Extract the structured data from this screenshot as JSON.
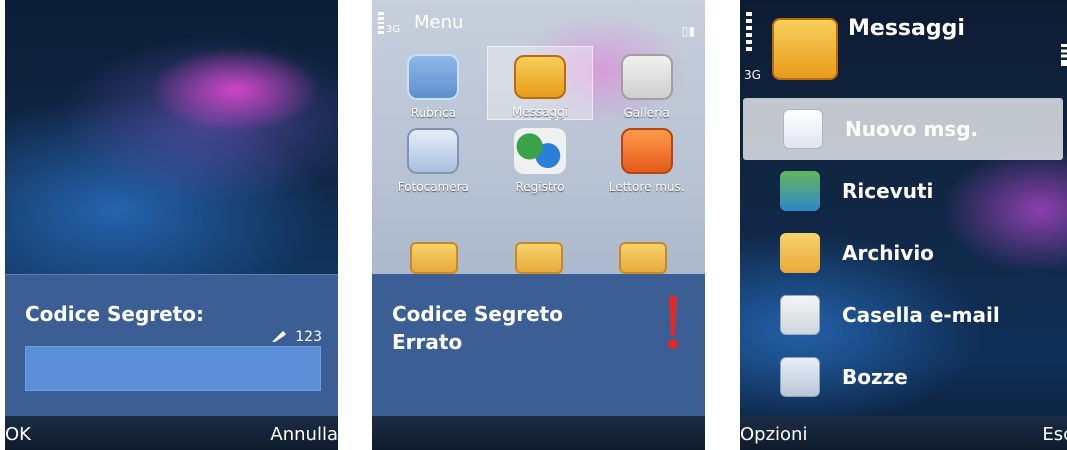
{
  "phone1": {
    "dialog_title": "Codice Segreto:",
    "input_mode": "123",
    "softkeys": {
      "left": "OK",
      "right": "Annulla"
    }
  },
  "phone2": {
    "status": {
      "network": "3G",
      "title": "Menu"
    },
    "grid": [
      {
        "label": "Rubrica",
        "icon": "contacts-icon",
        "selected": false
      },
      {
        "label": "Messaggi",
        "icon": "messages-icon",
        "selected": true
      },
      {
        "label": "Galleria",
        "icon": "gallery-icon",
        "selected": false
      },
      {
        "label": "Fotocamera",
        "icon": "camera-icon",
        "selected": false
      },
      {
        "label": "Registro",
        "icon": "log-icon",
        "selected": false
      },
      {
        "label": "Lettore mus.",
        "icon": "music-icon",
        "selected": false
      }
    ],
    "dialog_lines": [
      "Codice Segreto",
      "Errato"
    ],
    "warning_icon": "warning-icon"
  },
  "phone3": {
    "status": {
      "network": "3G",
      "title": "Messaggi"
    },
    "items": [
      {
        "label": "Nuovo msg.",
        "icon": "new-message-icon",
        "selected": true
      },
      {
        "label": "Ricevuti",
        "icon": "inbox-icon",
        "selected": false
      },
      {
        "label": "Archivio",
        "icon": "archive-icon",
        "selected": false
      },
      {
        "label": "Casella e-mail",
        "icon": "mailbox-icon",
        "selected": false
      },
      {
        "label": "Bozze",
        "icon": "drafts-icon",
        "selected": false
      }
    ],
    "softkeys": {
      "left": "Opzioni",
      "right": "Esc"
    }
  }
}
